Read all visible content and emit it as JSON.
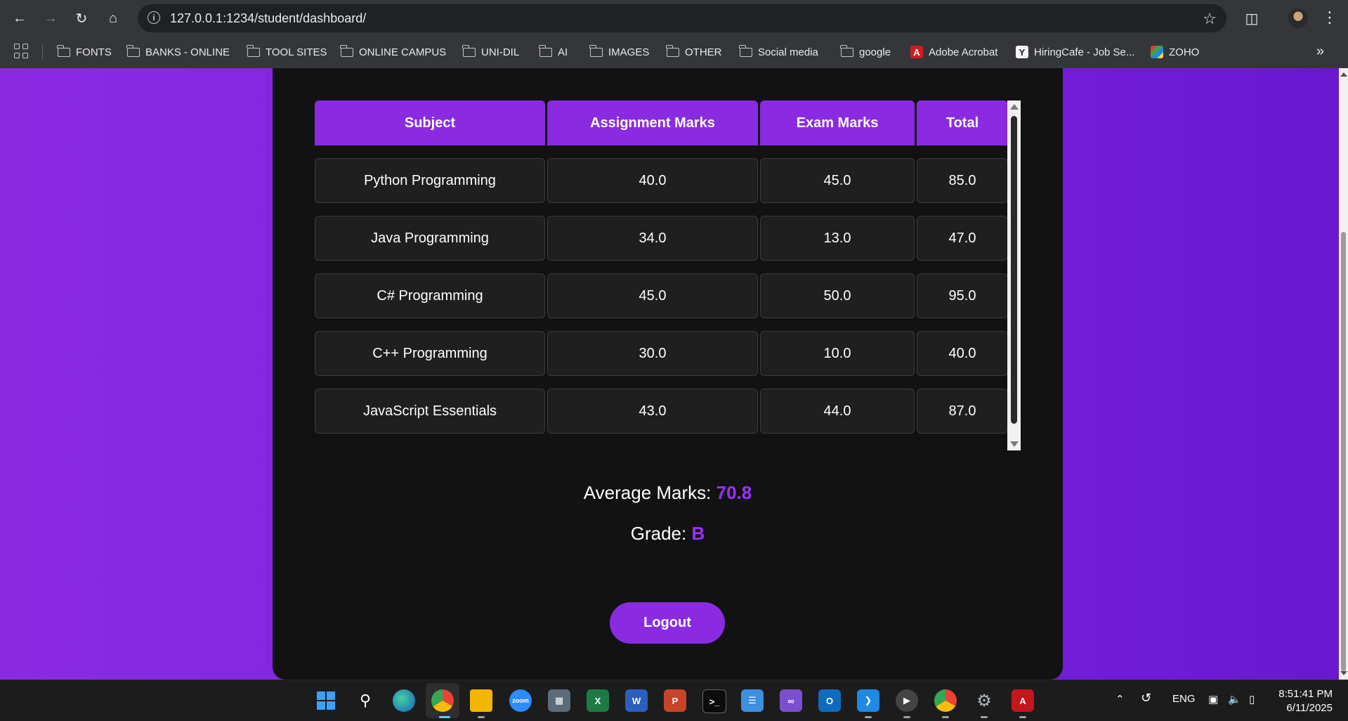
{
  "browser": {
    "url": "127.0.0.1:1234/student/dashboard/",
    "bookmarks": [
      "FONTS",
      "BANKS - ONLINE",
      "TOOL SITES",
      "ONLINE CAMPUS",
      "UNI-DIL",
      "AI",
      "IMAGES",
      "OTHER",
      "Social media",
      "google",
      "Adobe Acrobat",
      "HiringCafe - Job Se...",
      "ZOHO"
    ]
  },
  "table": {
    "headers": [
      "Subject",
      "Assignment Marks",
      "Exam Marks",
      "Total"
    ],
    "rows": [
      [
        "Python Programming",
        "40.0",
        "45.0",
        "85.0"
      ],
      [
        "Java Programming",
        "34.0",
        "13.0",
        "47.0"
      ],
      [
        "C# Programming",
        "45.0",
        "50.0",
        "95.0"
      ],
      [
        "C++ Programming",
        "30.0",
        "10.0",
        "40.0"
      ],
      [
        "JavaScript Essentials",
        "43.0",
        "44.0",
        "87.0"
      ]
    ]
  },
  "summary": {
    "average_label": "Average Marks:",
    "average_value": "70.8",
    "grade_label": "Grade:",
    "grade_value": "B"
  },
  "logout_label": "Logout",
  "taskbar": {
    "language": "ENG",
    "time": "8:51:41 PM",
    "date": "6/11/2025"
  },
  "colors": {
    "accent": "#8a2be2",
    "page_bg": "#7d1fe0",
    "card_bg": "#121212",
    "cell_bg": "#1f1f1f"
  }
}
